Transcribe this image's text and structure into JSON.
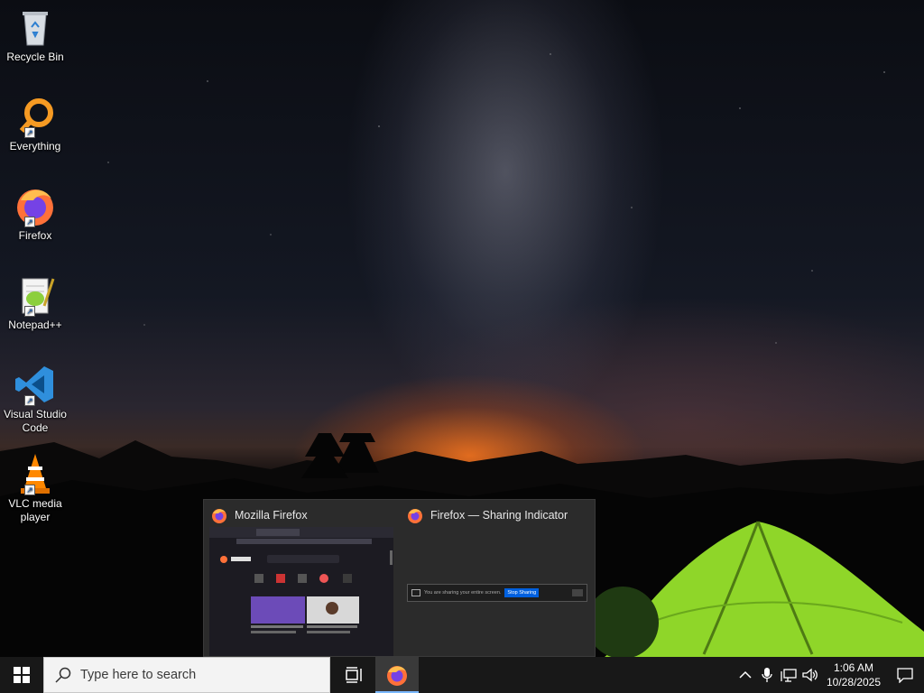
{
  "desktop": {
    "icons": [
      {
        "label": "Recycle Bin",
        "icon": "recycle-bin-icon"
      },
      {
        "label": "Everything",
        "icon": "everything-search-icon"
      },
      {
        "label": "Firefox",
        "icon": "firefox-icon"
      },
      {
        "label": "Notepad++",
        "icon": "notepadpp-icon"
      },
      {
        "label": "Visual Studio\nCode",
        "icon": "vscode-icon"
      },
      {
        "label": "VLC media\nplayer",
        "icon": "vlc-icon"
      }
    ]
  },
  "preview": {
    "windows": [
      {
        "title": "Mozilla Firefox",
        "icon": "firefox-icon"
      },
      {
        "title": "Firefox — Sharing Indicator",
        "icon": "firefox-icon"
      }
    ],
    "sharing_bar": {
      "message": "You are sharing your entire screen.",
      "stop_label": "Stop Sharing"
    }
  },
  "taskbar": {
    "search_placeholder": "Type here to search",
    "clock_time": "1:06 AM",
    "clock_date": "10/28/2025"
  },
  "colors": {
    "taskbar_bg": "#181818",
    "accent": "#7ab8ff",
    "tent_green": "#8fd629"
  }
}
